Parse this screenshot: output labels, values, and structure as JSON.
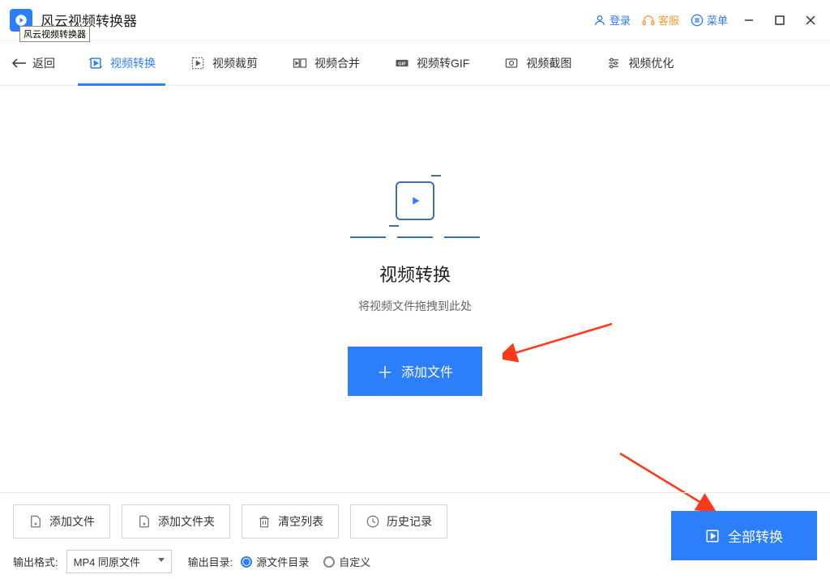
{
  "app": {
    "title": "风云视频转换器"
  },
  "tooltip": "风云视频转换器",
  "title_actions": {
    "login": "登录",
    "support": "客服",
    "menu": "菜单"
  },
  "nav": {
    "back": "返回",
    "tabs": [
      {
        "label": "视频转换",
        "icon": "convert-play-icon"
      },
      {
        "label": "视频裁剪",
        "icon": "crop-icon"
      },
      {
        "label": "视频合并",
        "icon": "merge-icon"
      },
      {
        "label": "视频转GIF",
        "icon": "gif-icon"
      },
      {
        "label": "视频截图",
        "icon": "screenshot-icon"
      },
      {
        "label": "视频优化",
        "icon": "optimize-icon"
      }
    ]
  },
  "hero": {
    "title": "视频转换",
    "hint": "将视频文件拖拽到此处",
    "add_file": "添加文件"
  },
  "bottom": {
    "add_file": "添加文件",
    "add_folder": "添加文件夹",
    "clear_list": "清空列表",
    "history": "历史记录",
    "out_format_label": "输出格式:",
    "out_format_value": "MP4 同原文件",
    "out_dir_label": "输出目录:",
    "out_dir_source": "源文件目录",
    "out_dir_custom": "自定义",
    "convert_all": "全部转换"
  }
}
